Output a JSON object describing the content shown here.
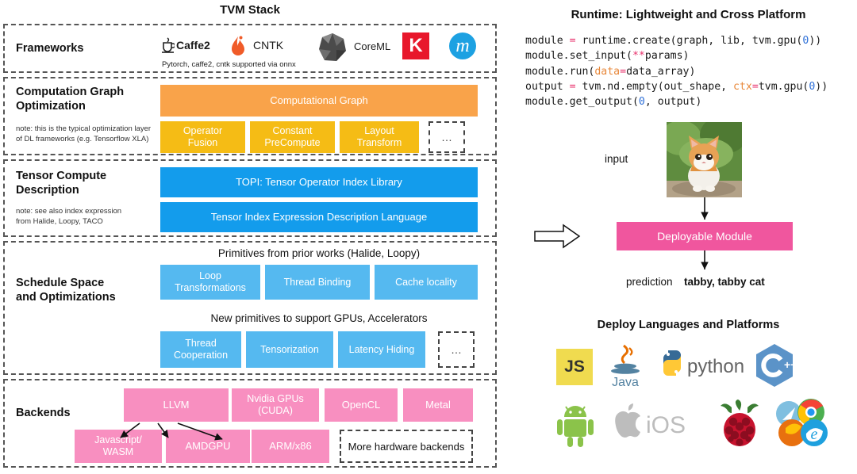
{
  "stack": {
    "title": "TVM Stack",
    "layers": [
      {
        "id": "frameworks",
        "label": "Frameworks",
        "note": "",
        "logos": [
          "caffe2-logo",
          "cntk-logo",
          "coreml-logo",
          "keras-logo",
          "mxnet-logo"
        ],
        "caffe2_label": "Caffe2",
        "caffe2_suffix": "2",
        "cntk_label": "CNTK",
        "coreml_label": "CoreML",
        "keras_label": "K",
        "mxnet_label": "m",
        "onnx_note": "Pytorch, caffe2, cntk supported via onnx"
      },
      {
        "id": "computation-graph-optimization",
        "label": "Computation Graph\nOptimization",
        "label_line1": "Computation Graph",
        "label_line2": "Optimization",
        "note_line1": "note: this is the typical optimization layer",
        "note_line2": "of DL frameworks (e.g. Tensorflow XLA)",
        "main_box": "Computational Graph",
        "boxes": [
          "Operator Fusion",
          "Constant PreCompute",
          "Layout Transform"
        ],
        "boxes_lines": [
          [
            "Operator",
            "Fusion"
          ],
          [
            "Constant",
            "PreCompute"
          ],
          [
            "Layout",
            "Transform"
          ]
        ],
        "ellipsis": "…"
      },
      {
        "id": "tensor-compute-description",
        "label_line1": "Tensor Compute",
        "label_line2": "Description",
        "note_line1": "note: see also index expression",
        "note_line2": "from Halide, Loopy, TACO",
        "box_top": "TOPI: Tensor Operator Index Library",
        "box_bottom": "Tensor Index Expression Description Language"
      },
      {
        "id": "schedule-space-and-optimizations",
        "label_line1": "Schedule Space",
        "label_line2": "and Optimizations",
        "heading_top": "Primitives from prior works (Halide, Loopy)",
        "heading_bottom": "New primitives to support GPUs, Accelerators",
        "row1": [
          [
            "Loop",
            "Transformations"
          ],
          [
            "Thread Binding",
            ""
          ],
          [
            "Cache locality",
            ""
          ]
        ],
        "row1_flat": [
          "Loop Transformations",
          "Thread Binding",
          "Cache locality"
        ],
        "row2": [
          [
            "Thread",
            "Cooperation"
          ],
          [
            "Tensorization",
            ""
          ],
          [
            "Latency Hiding",
            ""
          ]
        ],
        "row2_flat": [
          "Thread Cooperation",
          "Tensorization",
          "Latency Hiding"
        ],
        "ellipsis": "…"
      },
      {
        "id": "backends",
        "label": "Backends",
        "row1": [
          [
            "LLVM",
            ""
          ],
          [
            "Nvidia GPUs",
            "(CUDA)"
          ],
          [
            "OpenCL",
            ""
          ],
          [
            "Metal",
            ""
          ]
        ],
        "row1_flat": [
          "LLVM",
          "Nvidia GPUs (CUDA)",
          "OpenCL",
          "Metal"
        ],
        "row2": [
          [
            "Javascript/",
            "WASM"
          ],
          [
            "AMDGPU",
            ""
          ],
          [
            "ARM/x86",
            ""
          ]
        ],
        "row2_flat": [
          "Javascript/ WASM",
          "AMDGPU",
          "ARM/x86"
        ],
        "more_backends": "More hardware backends"
      }
    ]
  },
  "runtime": {
    "title": "Runtime: Lightweight and Cross Platform",
    "code_lines": [
      "module = runtime.create(graph, lib, tvm.gpu(0))",
      "module.set_input(**params)",
      "module.run(data=data_array)",
      "output = tvm.nd.empty(out_shape, ctx=tvm.gpu(0))",
      "module.get_output(0, output)"
    ],
    "input_label": "input",
    "deployable_module": "Deployable Module",
    "prediction_label": "prediction",
    "prediction_value": "tabby, tabby cat",
    "image_alt": "kitten-photo"
  },
  "deploy": {
    "title": "Deploy Languages and Platforms",
    "logos": [
      {
        "name": "javascript-logo",
        "label": "JS"
      },
      {
        "name": "java-logo",
        "label": "Java"
      },
      {
        "name": "python-logo",
        "label": "python"
      },
      {
        "name": "cpp-logo",
        "label": "C++"
      },
      {
        "name": "android-logo",
        "label": "Android"
      },
      {
        "name": "ios-logo",
        "label": "iOS"
      },
      {
        "name": "raspberry-pi-logo",
        "label": "Raspberry Pi"
      },
      {
        "name": "browsers-logo",
        "label": "Browsers"
      }
    ]
  },
  "colors": {
    "orange": "#F9A34A",
    "yellow": "#F5BC15",
    "blue_dark": "#139CEC",
    "blue_light": "#55B9F0",
    "pink": "#F88FC0",
    "pink_deep": "#F0569E",
    "border_dash": "#555555"
  }
}
